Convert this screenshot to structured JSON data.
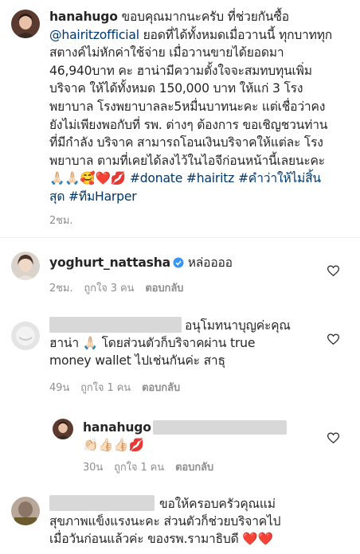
{
  "caption": {
    "username": "hanahugo",
    "line1_text": " ขอบคุณมากนะครับ ที่ช่วยกันซื้อ",
    "mention": "@hairitzofficial",
    "line2_text": " ยอดที่ได้ทั้งหมดเมื่อวานนี้ ทุกบาททุก",
    "line3": "สตางค์ไม่หักค่าใช้จ่าย เมื่อวานขายได้ยอดมา",
    "line4": "46,940บาท คะ ฮาน่ามีความตั้งใจจะสมทบทุนเพิ่ม",
    "line5": "บริจาค ให้ได้ทั้งหมด 150,000 บาท ให้แก่ 3 โรง",
    "line6": "พยาบาล โรงพยาบาลละ5หมื่นบาทนะคะ แต่เชื่อว่าคง",
    "line7": "ยังไม่เพียงพอกับที่ รพ. ต่างๆ ต้องการ ขอเชิญชวนท่าน",
    "line8": "ที่มีกำลัง บริจาค สามารถโอนเงินบริจาคให้แต่ละ โรง",
    "line9": "พยาบาล ตามที่เคยได้ลงไว้ในไอจีก่อนหน้านี้เลยนะคะ",
    "emojis": "🙏🏻🙏🏻🥰❤️💋",
    "hashtag1": "#donate",
    "hashtag2": "#hairitz",
    "hashtag3": "#คำว่าให้ไม่สิ้น",
    "hashtag3b": "สุด",
    "hashtag4": "#ทีมHarper",
    "time": "2ชม."
  },
  "comments": [
    {
      "username": "yoghurt_nattasha",
      "text": "หล่ออออ",
      "time": "2ชม.",
      "likes": "ถูกใจ 3 คน",
      "reply": "ตอบกลับ"
    },
    {
      "line1": "อนุโมทนาบุญค่ะคุณ",
      "line2": "ฮาน่า 🙏🏻 โดยส่วนตัวก็บริจาคผ่าน true",
      "line3": "money wallet ไปเช่นกันค่ะ สาธุ",
      "time": "49น",
      "likes": "ถูกใจ 1 คน",
      "reply": "ตอบกลับ"
    },
    {
      "username": "hanahugo",
      "emojis": "👏🏻👍🏻👍🏻💋",
      "time": "30น",
      "likes": "ถูกใจ 1 คน",
      "reply": "ตอบกลับ"
    },
    {
      "line1": "ขอให้ครอบครัวคุณแม่",
      "line2": "สุขภาพแข็งแรงนะคะ ส่วนตัวก็ช่วยบริจาคไป",
      "line3": "เมื่อวันก่อนแล้วค่ะ ของรพ.รามาธิบดี ❤️❤️"
    }
  ],
  "colors": {
    "link": "#00376b",
    "meta": "#8e8e8e",
    "verified": "#3897f0"
  }
}
